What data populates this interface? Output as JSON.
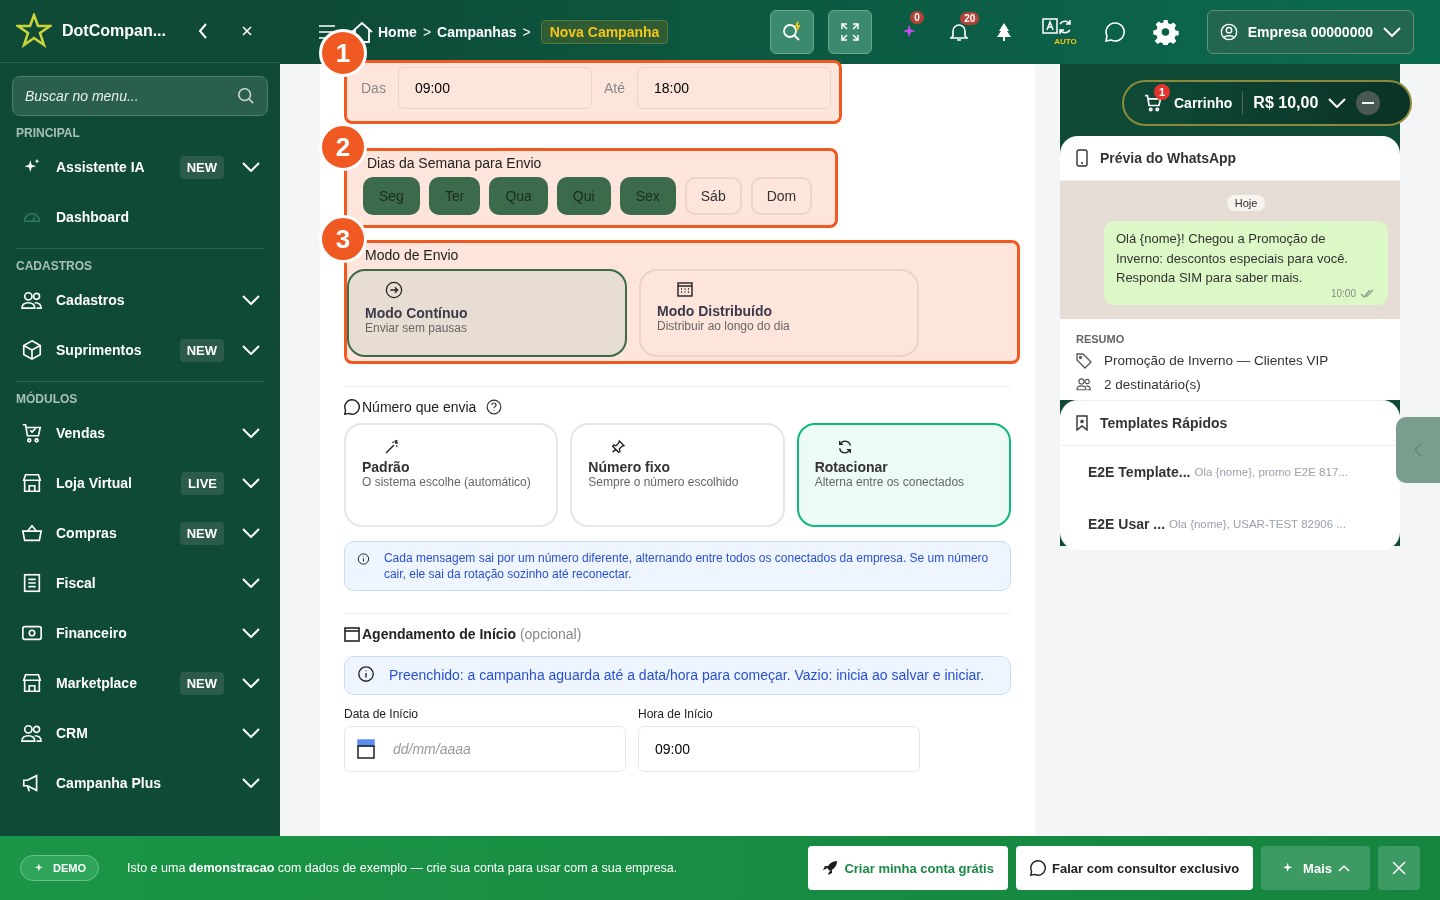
{
  "sidebar": {
    "brand": "DotCompan...",
    "search_placeholder": "Buscar no menu...",
    "sections": [
      {
        "title": "PRINCIPAL",
        "items": [
          {
            "label": "Assistente IA",
            "badge": "NEW",
            "expandable": true
          },
          {
            "label": "Dashboard",
            "expandable": false
          }
        ]
      },
      {
        "title": "CADASTROS",
        "items": [
          {
            "label": "Cadastros",
            "expandable": true
          },
          {
            "label": "Suprimentos",
            "badge": "NEW",
            "expandable": true
          }
        ]
      },
      {
        "title": "MÓDULOS",
        "items": [
          {
            "label": "Vendas",
            "expandable": true
          },
          {
            "label": "Loja Virtual",
            "badge": "LIVE",
            "expandable": true
          },
          {
            "label": "Compras",
            "badge": "NEW",
            "expandable": true
          },
          {
            "label": "Fiscal",
            "expandable": true
          },
          {
            "label": "Financeiro",
            "expandable": true
          },
          {
            "label": "Marketplace",
            "badge": "NEW",
            "expandable": true
          },
          {
            "label": "CRM",
            "expandable": true
          },
          {
            "label": "Campanha Plus",
            "expandable": true
          }
        ]
      }
    ]
  },
  "topbar": {
    "separator": ">",
    "breadcrumb": [
      {
        "label": "Home",
        "selected": false
      },
      {
        "label": "Campanhas",
        "selected": false
      },
      {
        "label": "Nova Campanha",
        "selected": true
      }
    ],
    "ai_count": "0",
    "notification_count": "20",
    "translate_label": "AUTO",
    "account": "Empresa 00000000"
  },
  "tutorial_steps": [
    "1",
    "2",
    "3"
  ],
  "hours": {
    "from_label": "Das",
    "from_value": "09:00",
    "to_label": "Até",
    "to_value": "18:00"
  },
  "days": {
    "title": "Dias da Semana para Envio",
    "items": [
      {
        "label": "Seg",
        "selected": true
      },
      {
        "label": "Ter",
        "selected": true
      },
      {
        "label": "Qua",
        "selected": true
      },
      {
        "label": "Qui",
        "selected": true
      },
      {
        "label": "Sex",
        "selected": true
      },
      {
        "label": "Sáb",
        "selected": false
      },
      {
        "label": "Dom",
        "selected": false
      }
    ]
  },
  "mode": {
    "title": "Modo de Envio",
    "options": [
      {
        "title": "Modo Contínuo",
        "subtitle": "Enviar sem pausas",
        "selected": true
      },
      {
        "title": "Modo Distribuído",
        "subtitle": "Distribuir ao longo do dia",
        "selected": false
      }
    ]
  },
  "sender": {
    "title": "Número que envia",
    "options": [
      {
        "title": "Padrão",
        "subtitle": "O sistema escolhe (automático)",
        "selected": false
      },
      {
        "title": "Número fixo",
        "subtitle": "Sempre o número escolhido",
        "selected": false
      },
      {
        "title": "Rotacionar",
        "subtitle": "Alterna entre os conectados",
        "selected": true
      }
    ],
    "info": "Cada mensagem sai por um número diferente, alternando entre todos os conectados da empresa. Se um número cair, ele sai da rotação sozinho até reconectar."
  },
  "schedule": {
    "title": "Agendamento de Início",
    "optional": "(opcional)",
    "info": "Preenchido: a campanha aguarda até a data/hora para começar. Vazio: inicia ao salvar e iniciar.",
    "date_label": "Data de Início",
    "date_placeholder": "dd/mm/aaaa",
    "time_label": "Hora de Início",
    "time_value": "09:00"
  },
  "cart": {
    "label": "Carrinho",
    "count": "1",
    "total": "R$ 10,00"
  },
  "preview": {
    "title": "Prévia do WhatsApp",
    "day": "Hoje",
    "message": "Olá {nome}! Chegou a Promoção de Inverno: descontos especiais para você. Responda SIM para saber mais.",
    "time": "10:00"
  },
  "summary": {
    "title": "RESUMO",
    "campaign": "Promoção de Inverno — Clientes VIP",
    "recipients": "2 destinatário(s)"
  },
  "templates": {
    "title": "Templates Rápidos",
    "items": [
      {
        "name": "E2E Template...",
        "preview": "Ola {nome}, promo E2E 817..."
      },
      {
        "name": "E2E Usar ...",
        "preview": "Ola {nome}, USAR-TEST 82906 ..."
      }
    ]
  },
  "banner": {
    "badge": "DEMO",
    "text": "Isto e uma **demonstracao** com dados de exemplo — crie sua conta para usar com a sua empresa.",
    "primary": "Criar minha conta grátis",
    "secondary": "Falar com consultor exclusivo",
    "more": "Mais"
  }
}
